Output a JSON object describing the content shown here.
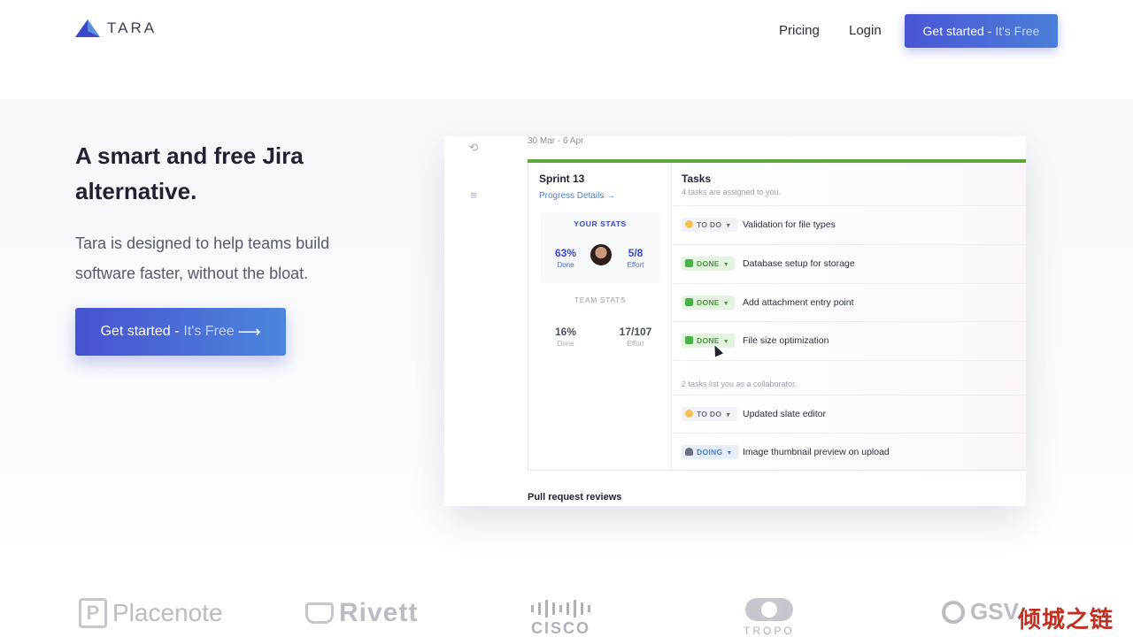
{
  "header": {
    "logo_text": "TARA",
    "nav": {
      "pricing": "Pricing",
      "login": "Login"
    },
    "cta": {
      "main": "Get started -",
      "free": "It's Free"
    }
  },
  "hero": {
    "title": "A smart and free Jira alternative.",
    "subtitle": "Tara is designed to help teams build software faster, without the bloat.",
    "cta": {
      "main": "Get started -",
      "free": "It's Free",
      "arrow": "⟶"
    }
  },
  "mock": {
    "date_range": "30 Mar - 6 Apr",
    "sprint": {
      "title": "Sprint 13",
      "progress_link": "Progress Details →",
      "your_stats": {
        "heading": "YOUR STATS",
        "done_value": "63%",
        "done_label": "Done",
        "effort_value": "5/8",
        "effort_label": "Effort"
      },
      "team_stats": {
        "heading": "TEAM STATS",
        "done_value": "16%",
        "done_label": "Done",
        "effort_value": "17/107",
        "effort_label": "Effort"
      }
    },
    "tasks": {
      "title": "Tasks",
      "subtitle": "4 tasks are assigned to you.",
      "collab_note": "2 tasks list you as a collaborator.",
      "items": [
        {
          "status": "TO DO",
          "label": "Validation for file types"
        },
        {
          "status": "DONE",
          "label": "Database setup for storage"
        },
        {
          "status": "DONE",
          "label": "Add attachment entry point"
        },
        {
          "status": "DONE",
          "label": "File size optimization"
        },
        {
          "status": "TO DO",
          "label": "Updated slate editor"
        },
        {
          "status": "DOING",
          "label": "Image thumbnail preview on upload"
        }
      ]
    },
    "footer_heading": "Pull request reviews"
  },
  "logos": {
    "placenote": {
      "mark": "P",
      "word": "Placenote"
    },
    "rivett": "Rivett",
    "cisco": "CISCO",
    "tropo": "TROPO",
    "gsv": "GSV"
  },
  "watermark": "倾城之链",
  "colors": {
    "accent": "#4a55d6",
    "done_green": "#5ca83d",
    "link_blue": "#4a7fd8"
  }
}
